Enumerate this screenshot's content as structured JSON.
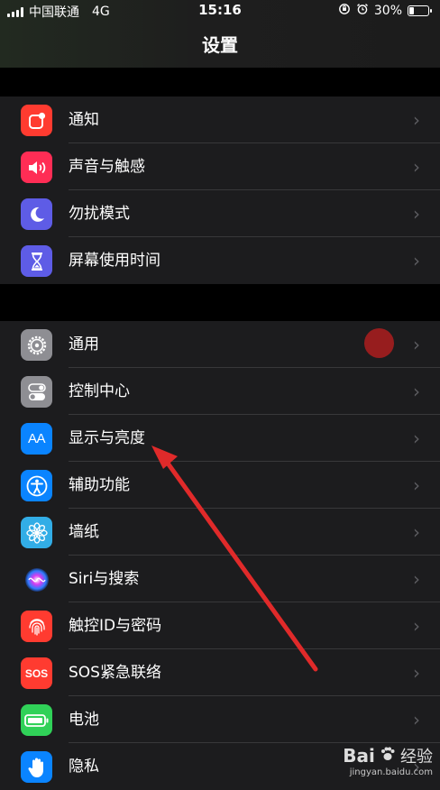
{
  "status_bar": {
    "carrier": "中国联通",
    "network": "4G",
    "time": "15:16",
    "battery_text": "30%",
    "battery_level": 0.3,
    "icons": [
      "signal-icon",
      "rotation-lock-icon",
      "alarm-icon",
      "battery-icon"
    ]
  },
  "header": {
    "title": "设置"
  },
  "group1": [
    {
      "label": "通知",
      "icon": "notifications-icon",
      "color": "#ff3b30"
    },
    {
      "label": "声音与触感",
      "icon": "sound-icon",
      "color": "#ff2d55"
    },
    {
      "label": "勿扰模式",
      "icon": "moon-icon",
      "color": "#5e5ce6"
    },
    {
      "label": "屏幕使用时间",
      "icon": "hourglass-icon",
      "color": "#5e5ce6"
    }
  ],
  "group2": [
    {
      "label": "通用",
      "icon": "gear-icon",
      "color": "#8e8e93"
    },
    {
      "label": "控制中心",
      "icon": "toggles-icon",
      "color": "#8e8e93"
    },
    {
      "label": "显示与亮度",
      "icon": "text-size-icon",
      "color": "#0a84ff"
    },
    {
      "label": "辅助功能",
      "icon": "accessibility-icon",
      "color": "#0a84ff"
    },
    {
      "label": "墙纸",
      "icon": "flower-icon",
      "color": "#32ade6"
    },
    {
      "label": "Siri与搜索",
      "icon": "siri-icon",
      "color": "#1c1c1e"
    },
    {
      "label": "触控ID与密码",
      "icon": "fingerprint-icon",
      "color": "#ff3b30"
    },
    {
      "label": "SOS紧急联络",
      "icon": "sos-icon",
      "color": "#ff3b30"
    },
    {
      "label": "电池",
      "icon": "battery-green-icon",
      "color": "#30d158"
    },
    {
      "label": "隐私",
      "icon": "hand-icon",
      "color": "#0a84ff"
    }
  ],
  "icon_glyphs": {
    "aa": "AA",
    "sos": "SOS"
  },
  "chevron": "›",
  "watermark": {
    "logo": "Bai",
    "brand": "经验",
    "url": "jingyan.baidu.com"
  }
}
